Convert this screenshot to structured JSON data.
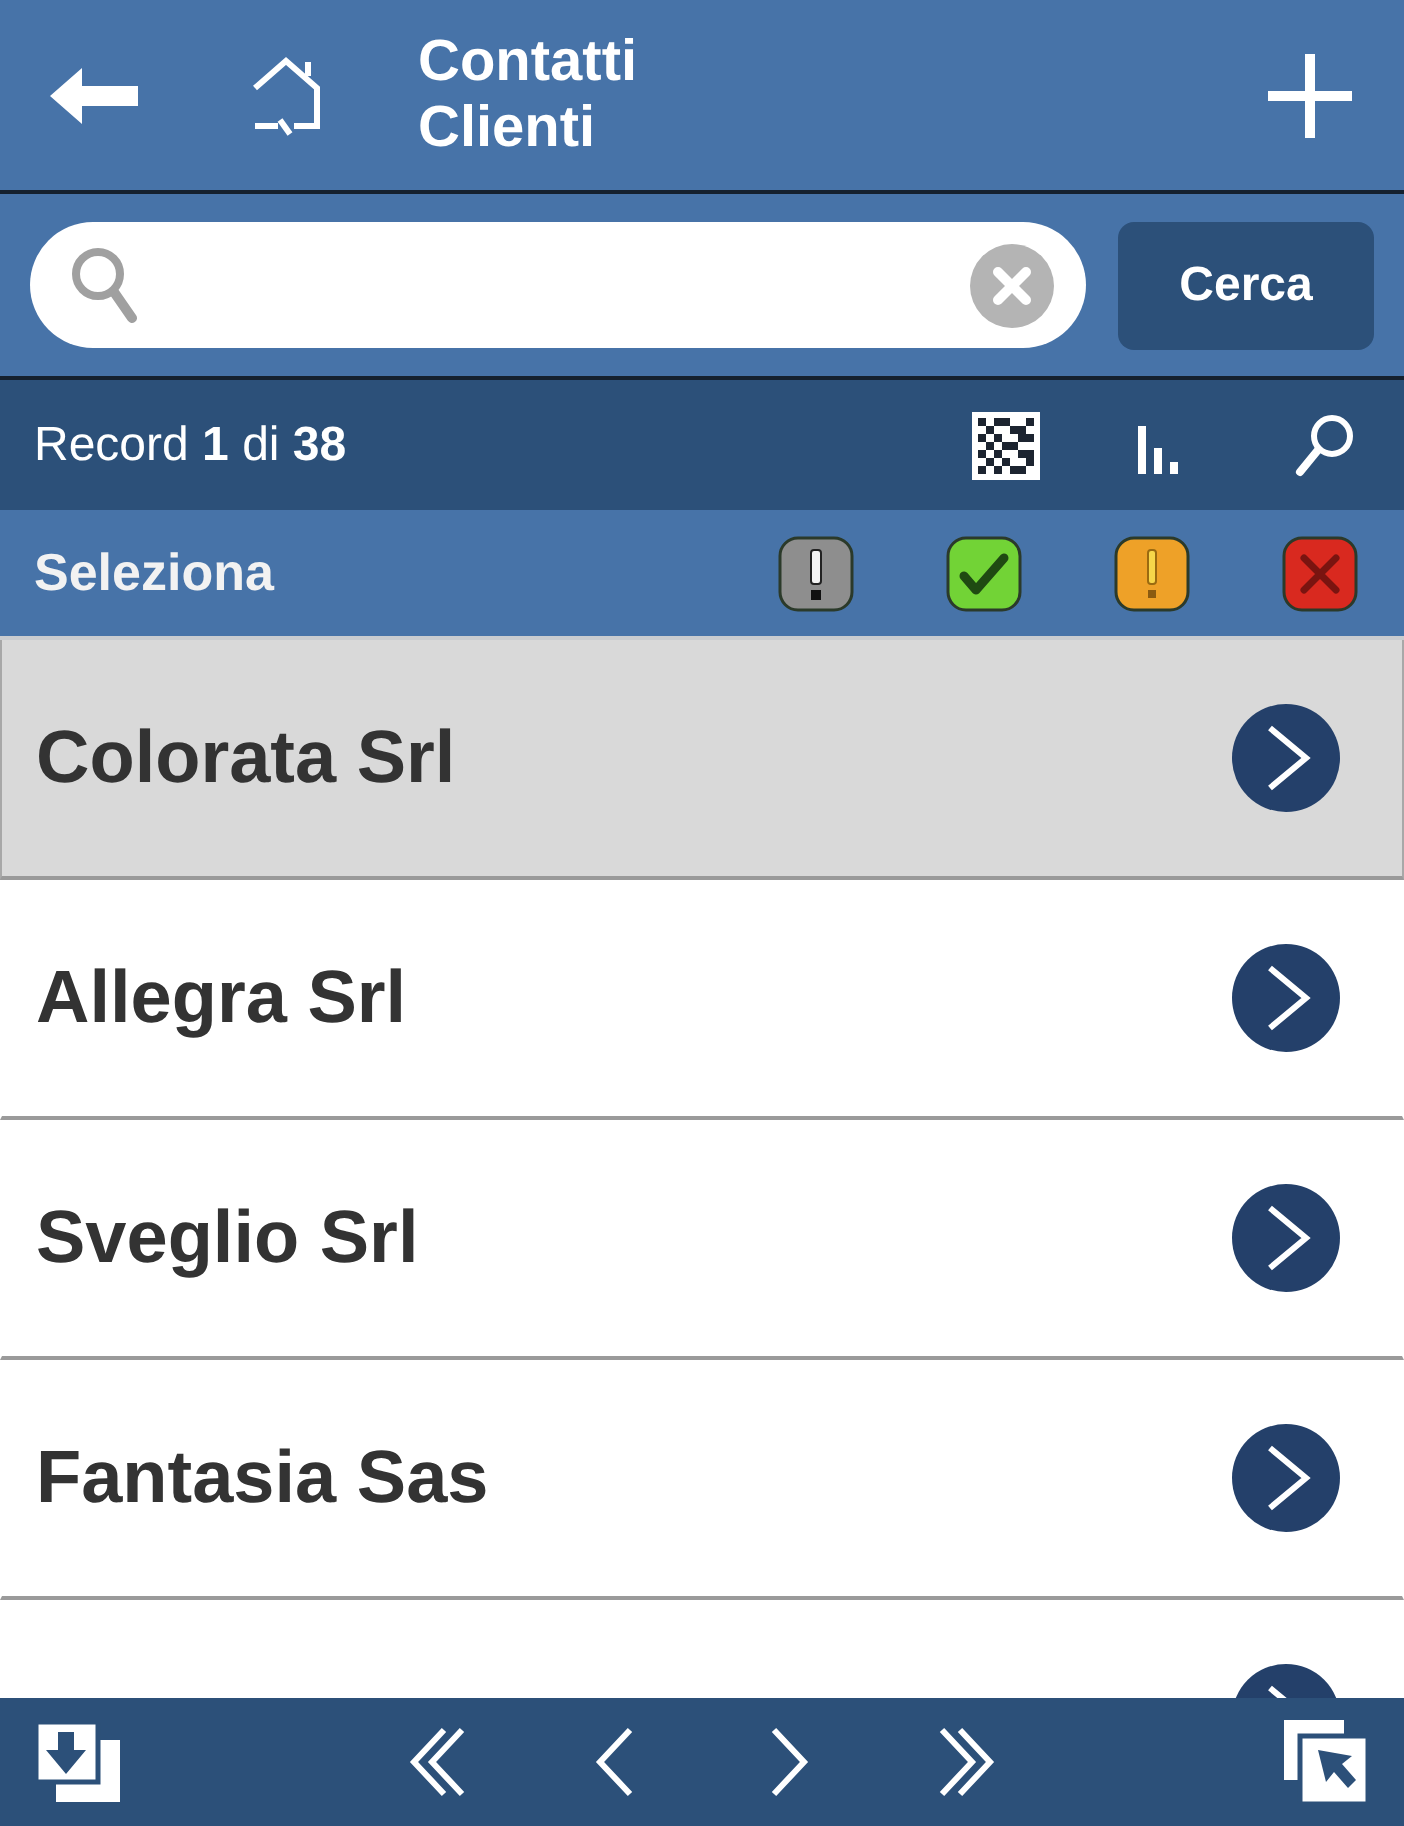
{
  "header": {
    "title": "Contatti Clienti"
  },
  "search": {
    "button": "Cerca"
  },
  "record_bar": {
    "text": "Record **1** di **38**"
  },
  "filter_bar": {
    "label": "Seleziona",
    "status_filters": [
      {
        "kind": "neutral",
        "color": "#8e8e8e"
      },
      {
        "kind": "ok",
        "color": "#72d336"
      },
      {
        "kind": "warning",
        "color": "#eea128"
      },
      {
        "kind": "error",
        "color": "#d9291f"
      }
    ]
  },
  "rows": [
    {
      "name": "Colorata Srl",
      "selected": true
    },
    {
      "name": "Allegra Srl",
      "selected": false
    },
    {
      "name": "Sveglio Srl",
      "selected": false
    },
    {
      "name": "Fantasia Sas",
      "selected": false
    },
    {
      "selected": false
    }
  ]
}
